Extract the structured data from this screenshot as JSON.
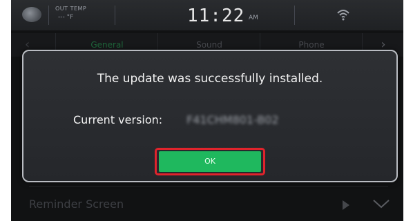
{
  "status_bar": {
    "out_temp_label": "OUT TEMP",
    "out_temp_value": "--- °F",
    "time": "11:22",
    "ampm": "AM"
  },
  "tabs": [
    {
      "label": "General",
      "active": true
    },
    {
      "label": "Sound",
      "active": false
    },
    {
      "label": "Phone",
      "active": false
    }
  ],
  "tab_next_glyph": "›",
  "tab_back_glyph": "‹",
  "dialog": {
    "message": "The update was successfully installed.",
    "version_label": "Current version:",
    "version_value": "F41CHM801-B02",
    "ok_label": "OK"
  },
  "background_row": {
    "label": "Reminder Screen"
  },
  "colors": {
    "ok_green": "#1fb85e",
    "highlight_red": "#e0242c",
    "active_tab": "#2f9b5a"
  },
  "icons": {
    "vehicle": "car-icon",
    "wifi": "wifi-icon",
    "play": "play-icon",
    "chevron": "chevron-down-icon"
  }
}
